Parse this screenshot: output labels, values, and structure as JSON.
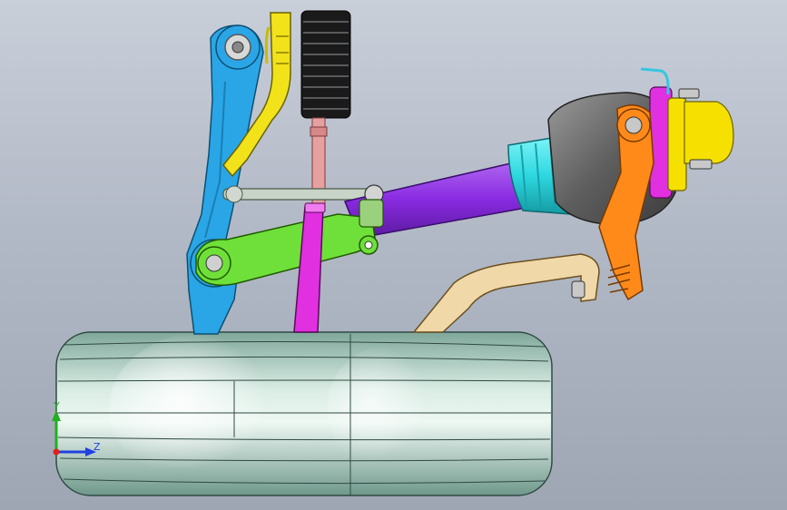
{
  "viewport": {
    "background_top": "#c9cfd9",
    "background_bottom": "#9ea6b4"
  },
  "triad": {
    "y_label": "Y",
    "z_label": "Z",
    "x_axis_color": "#e0201c",
    "y_axis_color": "#20b020",
    "z_axis_color": "#2040e0"
  },
  "parts": {
    "knuckle_color": "#2aa6e6",
    "strut_color": "#f2e21a",
    "boot_color": "#1a1a1a",
    "tie_rod_color": "#e7a0a0",
    "lower_arm_color": "#6fe03a",
    "drive_shaft_color": "#8a2be2",
    "cv_boot_color": "#2ed8e0",
    "hub_housing_color": "#6e6e6e",
    "hub_flange_color": "#f5e000",
    "caliper_color": "#ff8a1a",
    "link_color": "#f0d8a8",
    "damper_color": "#e030e0",
    "tire_color": "#a7c9bd"
  }
}
